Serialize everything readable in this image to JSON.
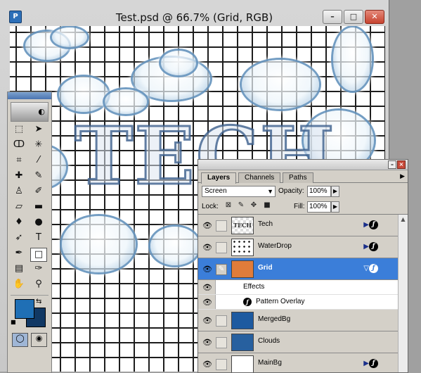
{
  "document": {
    "title": "Test.psd @ 66.7% (Grid, RGB)",
    "canvas_text": "TECH"
  },
  "window_controls": {
    "minimize": "–",
    "maximize": "□",
    "close": "✕"
  },
  "tools": {
    "logo": "◐",
    "items": [
      {
        "name": "marquee-tool-icon",
        "glyph": "⬚"
      },
      {
        "name": "move-tool-icon",
        "glyph": "➤"
      },
      {
        "name": "lasso-tool-icon",
        "glyph": "ↀ"
      },
      {
        "name": "magic-wand-tool-icon",
        "glyph": "✳"
      },
      {
        "name": "crop-tool-icon",
        "glyph": "⌗"
      },
      {
        "name": "slice-tool-icon",
        "glyph": "⁄"
      },
      {
        "name": "healing-brush-tool-icon",
        "glyph": "✚"
      },
      {
        "name": "brush-tool-icon",
        "glyph": "✎"
      },
      {
        "name": "clone-stamp-tool-icon",
        "glyph": "♙"
      },
      {
        "name": "history-brush-tool-icon",
        "glyph": "✐"
      },
      {
        "name": "eraser-tool-icon",
        "glyph": "▱"
      },
      {
        "name": "gradient-tool-icon",
        "glyph": "▬"
      },
      {
        "name": "blur-tool-icon",
        "glyph": "♦"
      },
      {
        "name": "dodge-tool-icon",
        "glyph": "●"
      },
      {
        "name": "path-selection-tool-icon",
        "glyph": "➶"
      },
      {
        "name": "type-tool-icon",
        "glyph": "T"
      },
      {
        "name": "pen-tool-icon",
        "glyph": "✒"
      },
      {
        "name": "shape-tool-icon",
        "glyph": "□"
      },
      {
        "name": "notes-tool-icon",
        "glyph": "▤"
      },
      {
        "name": "eyedropper-tool-icon",
        "glyph": "✑"
      },
      {
        "name": "hand-tool-icon",
        "glyph": "✋"
      },
      {
        "name": "zoom-tool-icon",
        "glyph": "⚲"
      }
    ],
    "swap_glyph": "⇆",
    "reset_glyph": "■",
    "mode_standard": "◯",
    "mode_quickmask": "◉",
    "colors": {
      "foreground": "#1f6fb5",
      "background": "#113864"
    }
  },
  "layers_panel": {
    "tabs": [
      "Layers",
      "Channels",
      "Paths"
    ],
    "menu_glyph": "▶",
    "blend_mode": "Screen",
    "opacity_label": "Opacity:",
    "opacity_value": "100%",
    "lock_label": "Lock:",
    "fill_label": "Fill:",
    "fill_value": "100%",
    "lock_icons": [
      "transparency-lock-icon",
      "brush-lock-icon",
      "move-lock-icon",
      "padlock-icon"
    ],
    "layers": [
      {
        "name": "Tech",
        "thumb": "TECH",
        "has_fx": true,
        "selected": false
      },
      {
        "name": "WaterDrop",
        "thumb": "",
        "has_fx": true,
        "selected": false
      },
      {
        "name": "Grid",
        "thumb": "",
        "has_fx": true,
        "selected": true
      },
      {
        "name": "MergedBg",
        "thumb": "",
        "has_fx": false,
        "selected": false
      },
      {
        "name": "Clouds",
        "thumb": "",
        "has_fx": false,
        "selected": false
      },
      {
        "name": "MainBg",
        "thumb": "",
        "has_fx": true,
        "selected": false
      }
    ],
    "effects_label": "Effects",
    "pattern_overlay_label": "Pattern Overlay",
    "accent_color": "#3b7ed9"
  }
}
